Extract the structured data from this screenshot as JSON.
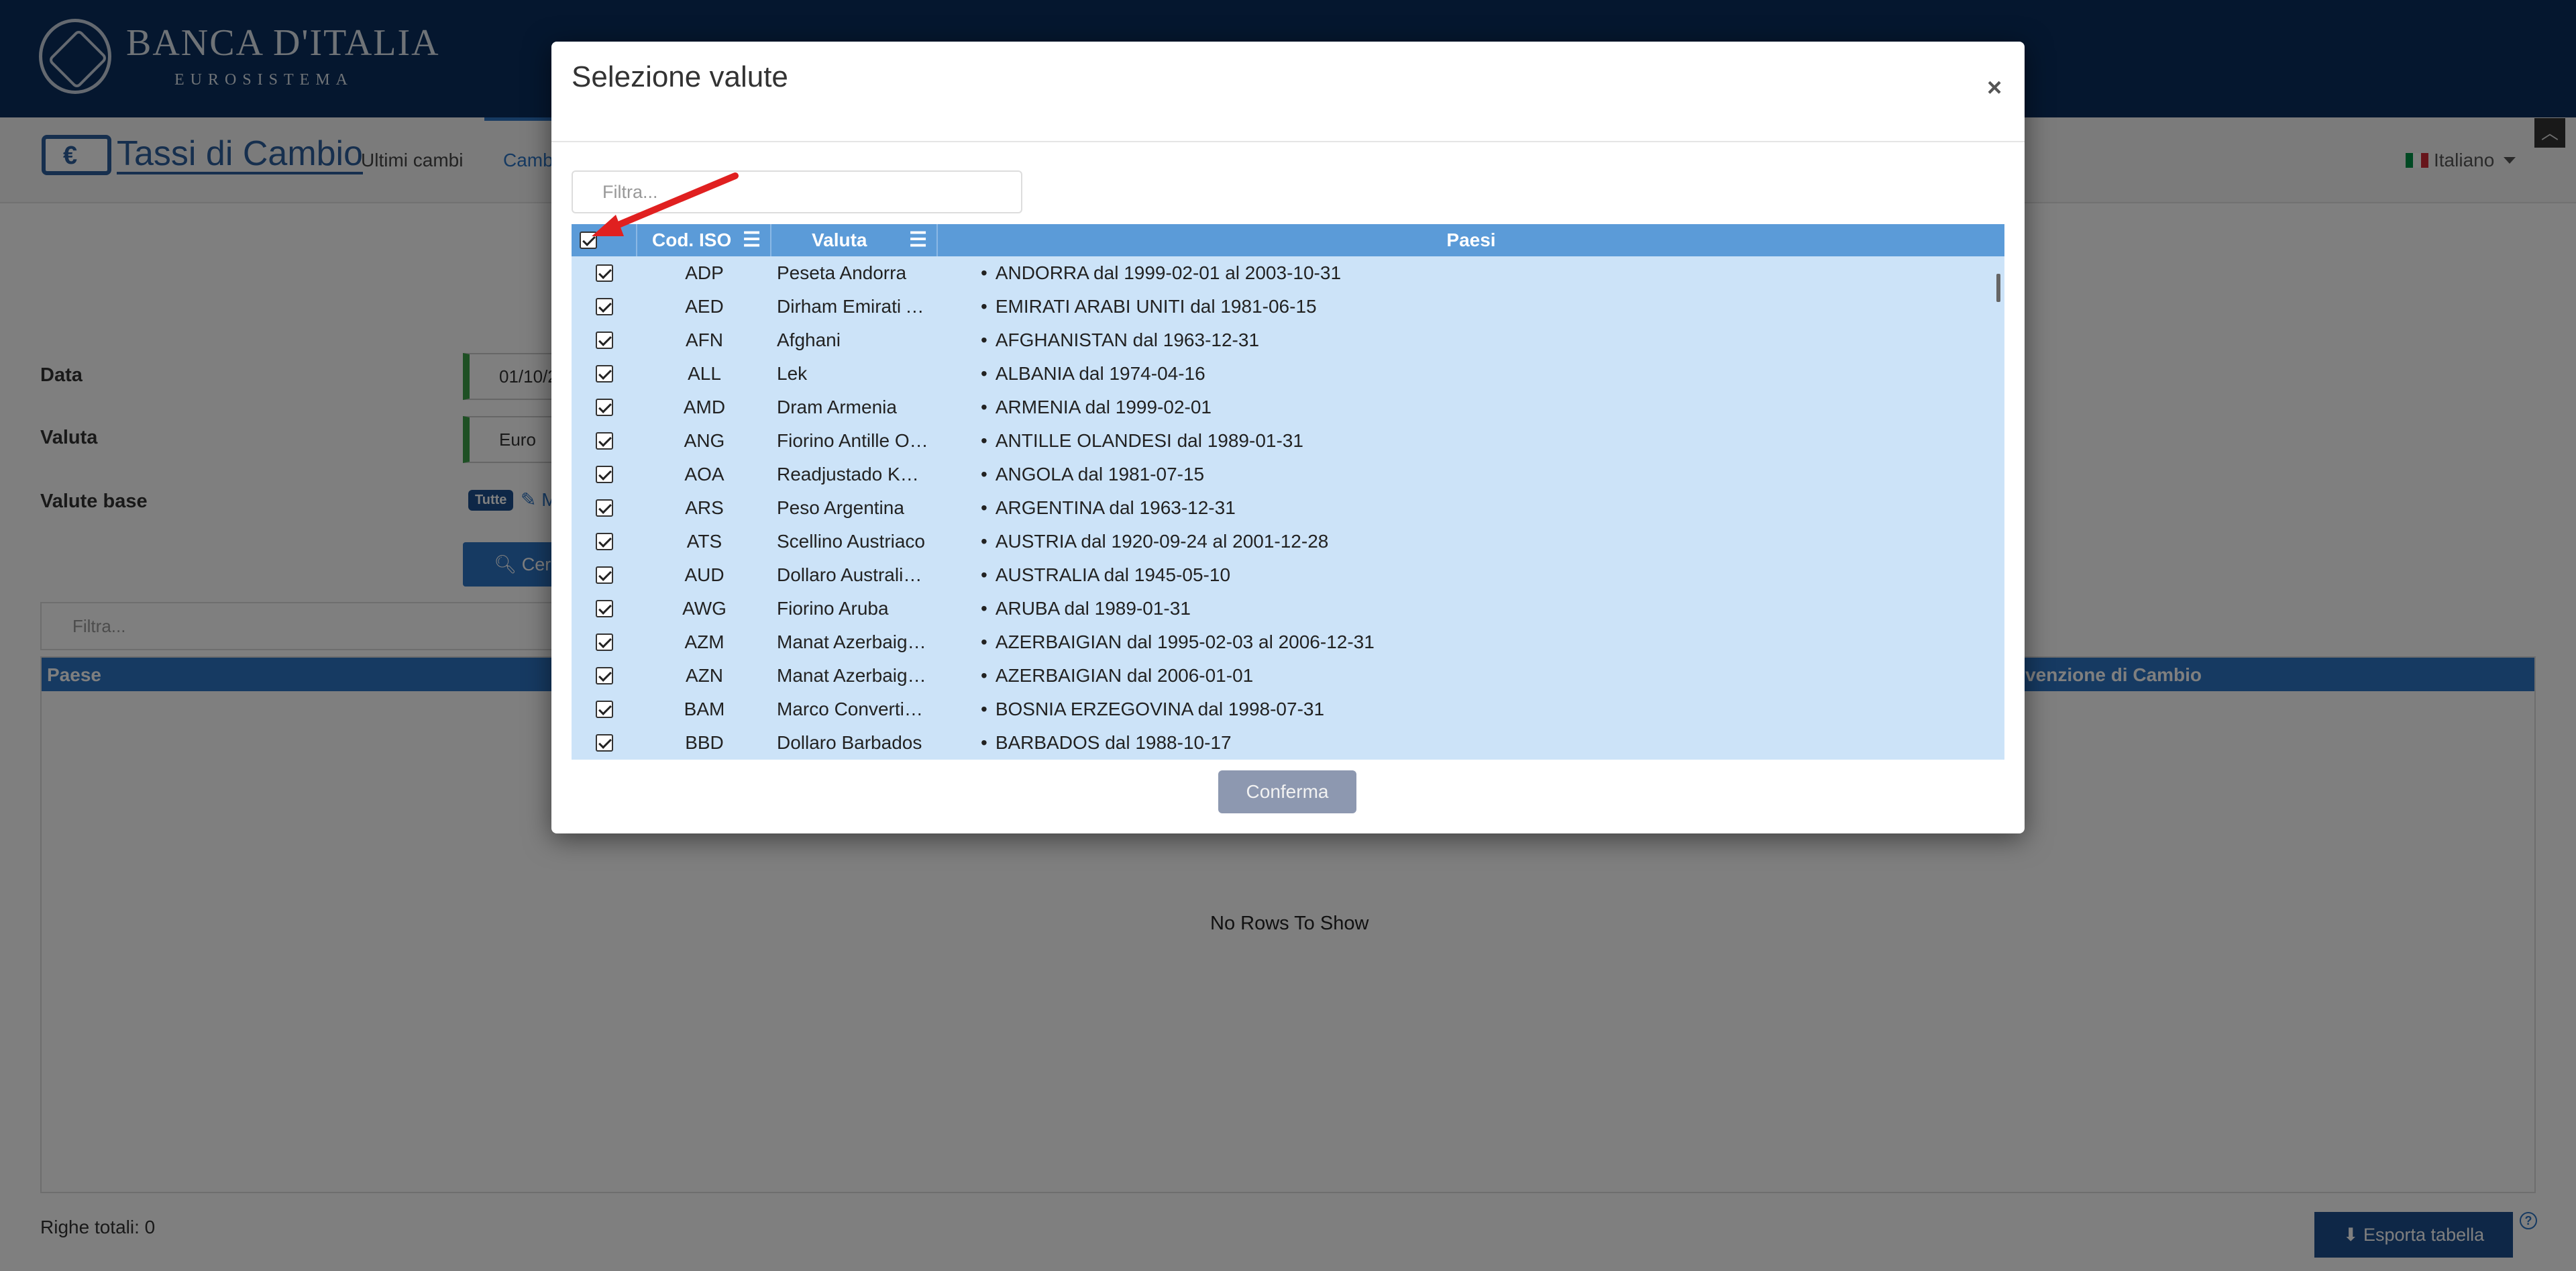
{
  "header": {
    "logo_title": "BANCA D'ITALIA",
    "logo_subtitle": "EUROSISTEMA"
  },
  "navbar": {
    "brand": "Tassi di Cambio",
    "links": [
      "Ultimi cambi",
      "Camb"
    ],
    "language": "Italiano",
    "scroll_top_icon": "chevron-up-icon"
  },
  "form": {
    "data_label": "Data",
    "data_value": "01/10/2",
    "valuta_label": "Valuta",
    "valuta_value": "Euro",
    "valute_base_label": "Valute base",
    "tutte_tag": "Tutte",
    "tutte_extra": "M",
    "cerca_label": "Cerc",
    "cerca_icon": "search-icon"
  },
  "grid": {
    "filter_placeholder": "Filtra...",
    "col_paese": "Paese",
    "col_convenzione": "nvenzione di Cambio",
    "no_rows": "No Rows To Show",
    "totals": "Righe totali: 0",
    "export_label": "Esporta tabella",
    "export_icon": "download-icon",
    "help_icon": "question-icon"
  },
  "modal": {
    "title": "Selezione valute",
    "close": "×",
    "filter_placeholder": "Filtra...",
    "headers": {
      "iso": "Cod. ISO",
      "valuta": "Valuta",
      "paesi": "Paesi",
      "menu_icon": "☰"
    },
    "rows": [
      {
        "iso": "ADP",
        "valuta": "Peseta Andorra",
        "paesi": "ANDORRA dal 1999-02-01 al 2003-10-31",
        "checked": true
      },
      {
        "iso": "AED",
        "valuta": "Dirham Emirati Arabi Uniti",
        "paesi": "EMIRATI ARABI UNITI dal 1981-06-15",
        "checked": true
      },
      {
        "iso": "AFN",
        "valuta": "Afghani",
        "paesi": "AFGHANISTAN dal 1963-12-31",
        "checked": true
      },
      {
        "iso": "ALL",
        "valuta": "Lek",
        "paesi": "ALBANIA dal 1974-04-16",
        "checked": true
      },
      {
        "iso": "AMD",
        "valuta": "Dram Armenia",
        "paesi": "ARMENIA dal 1999-02-01",
        "checked": true
      },
      {
        "iso": "ANG",
        "valuta": "Fiorino Antille Olandesi",
        "paesi": "ANTILLE OLANDESI dal 1989-01-31",
        "checked": true
      },
      {
        "iso": "AOA",
        "valuta": "Readjustado Kwanza",
        "paesi": "ANGOLA dal 1981-07-15",
        "checked": true
      },
      {
        "iso": "ARS",
        "valuta": "Peso Argentina",
        "paesi": "ARGENTINA dal 1963-12-31",
        "checked": true
      },
      {
        "iso": "ATS",
        "valuta": "Scellino Austriaco",
        "paesi": "AUSTRIA dal 1920-09-24 al 2001-12-28",
        "checked": true
      },
      {
        "iso": "AUD",
        "valuta": "Dollaro Australiano",
        "paesi": "AUSTRALIA dal 1945-05-10",
        "checked": true
      },
      {
        "iso": "AWG",
        "valuta": "Fiorino Aruba",
        "paesi": "ARUBA dal 1989-01-31",
        "checked": true
      },
      {
        "iso": "AZM",
        "valuta": "Manat Azerbaigian",
        "paesi": "AZERBAIGIAN dal 1995-02-03 al 2006-12-31",
        "checked": true
      },
      {
        "iso": "AZN",
        "valuta": "Manat Azerbaigian",
        "paesi": "AZERBAIGIAN dal 2006-01-01",
        "checked": true
      },
      {
        "iso": "BAM",
        "valuta": "Marco Convertibile",
        "paesi": "BOSNIA ERZEGOVINA dal 1998-07-31",
        "checked": true
      },
      {
        "iso": "BBD",
        "valuta": "Dollaro Barbados",
        "paesi": "BARBADOS dal 1988-10-17",
        "checked": true
      }
    ],
    "confirm_label": "Conferma"
  },
  "colors": {
    "topbar": "#0a2f5e",
    "header_blue": "#5b9bd8",
    "row_blue": "#cce3f8",
    "accent": "#2c74c4",
    "annotation_arrow": "#e02020"
  }
}
